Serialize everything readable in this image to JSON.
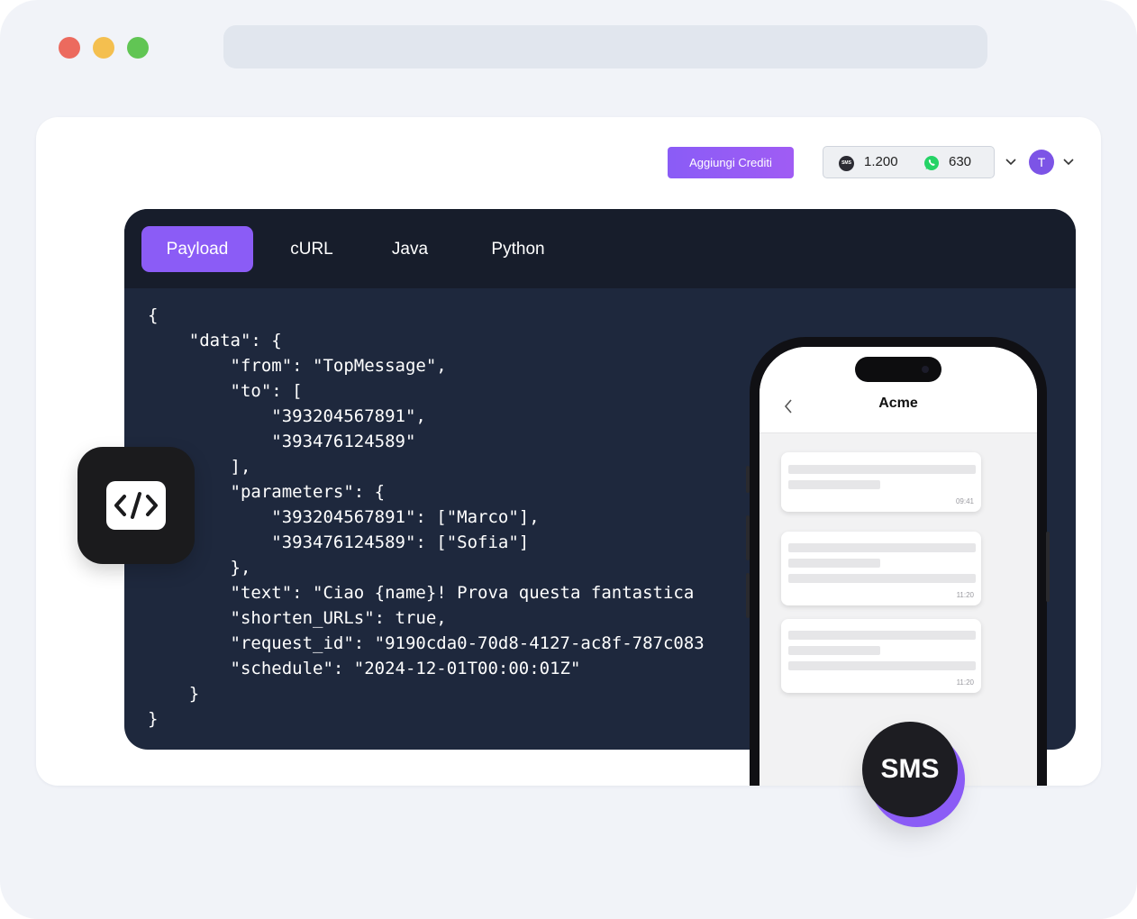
{
  "browser": {
    "window_controls": [
      "close",
      "minimize",
      "maximize"
    ]
  },
  "header": {
    "add_credits_label": "Aggiungi Crediti",
    "sms_icon_text": "SMS",
    "sms_credits": "1.200",
    "whatsapp_credits": "630",
    "avatar_initial": "T"
  },
  "code": {
    "tabs": [
      {
        "label": "Payload",
        "active": true
      },
      {
        "label": "cURL",
        "active": false
      },
      {
        "label": "Java",
        "active": false
      },
      {
        "label": "Python",
        "active": false
      }
    ],
    "payload_text": "{\n    \"data\": {\n        \"from\": \"TopMessage\",\n        \"to\": [\n            \"393204567891\",\n            \"393476124589\"\n        ],\n        \"parameters\": {\n            \"393204567891\": [\"Marco\"],\n            \"393476124589\": [\"Sofia\"]\n        },\n        \"text\": \"Ciao {name}! Prova questa fantastica\n        \"shorten_URLs\": true,\n        \"request_id\": \"9190cda0-70d8-4127-ac8f-787c083\n        \"schedule\": \"2024-12-01T00:00:01Z\"\n    }\n}"
  },
  "phone": {
    "contact_name": "Acme",
    "messages": [
      {
        "time": "09:41"
      },
      {
        "time": "11:20"
      },
      {
        "time": "11:20"
      }
    ]
  },
  "badges": {
    "sms_label": "SMS",
    "code_icon": "code-brackets-icon"
  },
  "colors": {
    "accent": "#8b5cf6",
    "code_bg": "#1e283d",
    "tabs_bg": "#171d2b"
  }
}
